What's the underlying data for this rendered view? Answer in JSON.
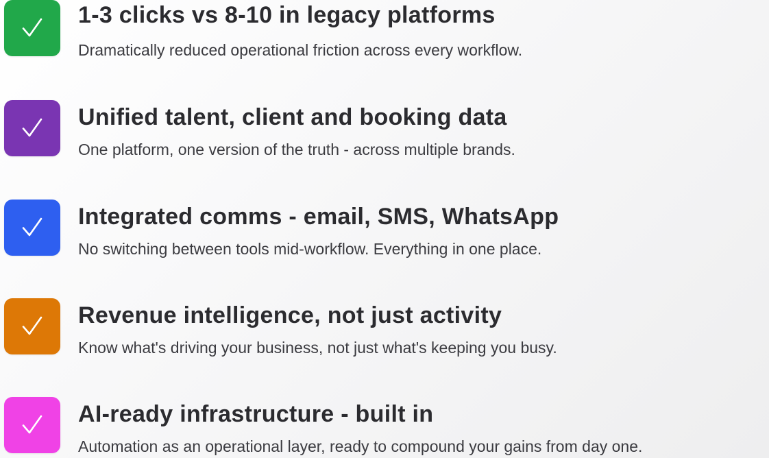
{
  "features": [
    {
      "title": "1-3 clicks vs 8-10 in legacy platforms",
      "description": "Dramatically reduced operational friction across every workflow.",
      "color": "#21a84a",
      "icon": "check-icon"
    },
    {
      "title": "Unified talent, client and booking data",
      "description": "One platform, one version of the truth - across multiple brands.",
      "color": "#7a35b2",
      "icon": "check-icon"
    },
    {
      "title": "Integrated comms - email, SMS, WhatsApp",
      "description": "No switching between tools mid-workflow. Everything in one place.",
      "color": "#2e5ff0",
      "icon": "check-icon"
    },
    {
      "title": "Revenue intelligence, not just activity",
      "description": "Know what's driving your business, not just what's keeping you busy.",
      "color": "#dd7806",
      "icon": "check-icon"
    },
    {
      "title": "AI-ready infrastructure - built in",
      "description": "Automation as an operational layer, ready to compound your gains from day one.",
      "color": "#f042e6",
      "icon": "check-icon"
    }
  ]
}
